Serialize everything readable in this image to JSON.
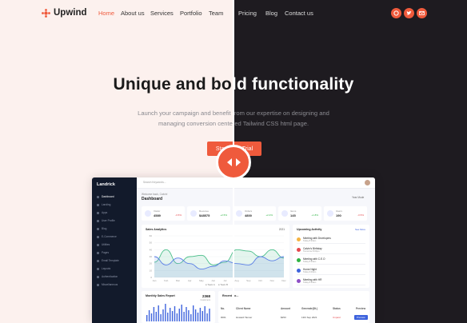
{
  "brand": {
    "name": "Upwind",
    "color": "#ef5a3c"
  },
  "nav": {
    "items": [
      "Home",
      "About us",
      "Services",
      "Portfolio",
      "Team",
      "Pricing",
      "Blog",
      "Contact us"
    ],
    "active": "Home"
  },
  "socials": [
    {
      "icon": "github-icon"
    },
    {
      "icon": "twitter-icon"
    },
    {
      "icon": "mail-icon"
    }
  ],
  "hero": {
    "title": "Unique and bold functionality",
    "subtitle_line1": "Launch your campaign and benefit from our expertise on designing and",
    "subtitle_line2": "managing conversion centered Tailwind CSS html page.",
    "cta_label": "Start Free Trial"
  },
  "dashboard": {
    "brand": "Landrick",
    "sidebar": [
      "Dashboard",
      "Landing",
      "Apps",
      "User Profile",
      "Blog",
      "E-Commerce",
      "Utilities",
      "Pages",
      "Email Template",
      "Layouts",
      "Authentication",
      "Miscellaneous"
    ],
    "search_placeholder": "Search Keywords...",
    "breadcrumb": "Welcome back, Calvin!",
    "title": "Dashboard",
    "period": "Year Mode",
    "stats": [
      {
        "label": "Visitor",
        "value": "4589",
        "change": "-0.5%"
      },
      {
        "label": "Revenue",
        "value": "$48575",
        "change": "+2.5%"
      },
      {
        "label": "Orders",
        "value": "4800",
        "change": "+2.4%"
      },
      {
        "label": "Items",
        "value": "145",
        "change": "+1.8%"
      },
      {
        "label": "Users",
        "value": "190",
        "change": "-0.5%"
      }
    ],
    "sales_chart": {
      "title": "Sales Analytics",
      "filter": "2021",
      "months": [
        "Jan",
        "Feb",
        "Mar",
        "Apr",
        "May",
        "Jun",
        "Jul",
        "Aug",
        "Sep",
        "Oct",
        "Nov",
        "Dec"
      ],
      "yticks": [
        "60",
        "50",
        "40",
        "30",
        "20",
        "10",
        "0"
      ],
      "legend": [
        "Team A",
        "Team B"
      ],
      "series_a": [
        22,
        40,
        20,
        30,
        32,
        18,
        22,
        40,
        38,
        30,
        40,
        28
      ],
      "series_b": [
        30,
        18,
        28,
        20,
        12,
        16,
        24,
        20,
        18,
        30,
        24,
        30
      ]
    },
    "activity": {
      "title": "Upcoming Activity",
      "link": "See More",
      "items": [
        {
          "title": "Meeting with Developers",
          "sub": "Today 8:30am",
          "color": "#f5b342"
        },
        {
          "title": "Calvin's Birthday",
          "sub": "Tomorrow 8:00pm",
          "color": "#e5484d"
        },
        {
          "title": "Meeting with C.E.O",
          "sub": "Today 8:30am",
          "color": "#2fb344"
        },
        {
          "title": "Home Night",
          "sub": "Today 9:00pm",
          "color": "#3e63dd"
        },
        {
          "title": "Meeting with HR",
          "sub": "Today 8:30am",
          "color": "#8e4ec6"
        }
      ]
    },
    "monthly": {
      "title": "Monthly Sales Report",
      "value": "2368",
      "sub": "Customers"
    },
    "recent": {
      "title": "Recent Lo..."
    },
    "table": {
      "headers": [
        "No.",
        "Client Name",
        "Amount",
        "Generate(Dt.)",
        "Status",
        "Preview"
      ],
      "row": [
        "#001",
        "Howard Tanner",
        "$253",
        "13th Sep 2021",
        "Unpaid",
        "Preview"
      ]
    }
  }
}
